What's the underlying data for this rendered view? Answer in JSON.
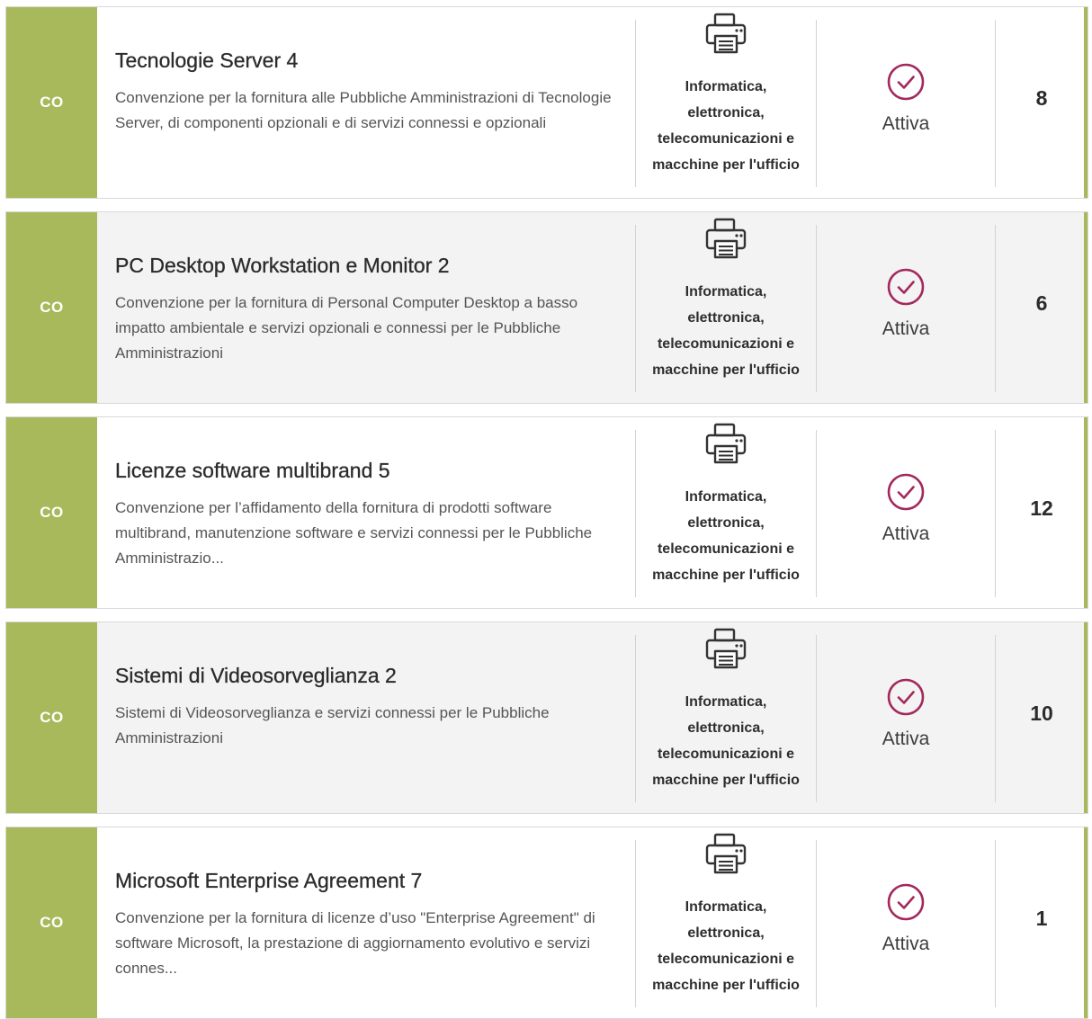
{
  "colors": {
    "type_badge_bg": "#a8b95c",
    "status_active": "#a3285d",
    "row_alt_bg": "#f3f3f3"
  },
  "items": [
    {
      "type": "CO",
      "title": "Tecnologie Server 4",
      "description": "Convenzione per la fornitura alle Pubbliche Amministrazioni di Tecnologie Server, di componenti opzionali e di servizi connessi e opzionali",
      "category_icon": "printer-icon",
      "category": "Informatica, elettronica, telecomunicazioni e macchine per l'ufficio",
      "status_icon": "check-circle-icon",
      "status": "Attiva",
      "count": "8"
    },
    {
      "type": "CO",
      "title": "PC Desktop Workstation e Monitor 2",
      "description": "Convenzione per la fornitura di Personal Computer Desktop a basso impatto ambientale e servizi opzionali e connessi per le Pubbliche Amministrazioni",
      "category_icon": "printer-icon",
      "category": "Informatica, elettronica, telecomunicazioni e macchine per l'ufficio",
      "status_icon": "check-circle-icon",
      "status": "Attiva",
      "count": "6"
    },
    {
      "type": "CO",
      "title": "Licenze software multibrand 5",
      "description": "Convenzione per l’affidamento della fornitura di prodotti software multibrand, manutenzione software e servizi connessi per le Pubbliche Amministrazio...",
      "category_icon": "printer-icon",
      "category": "Informatica, elettronica, telecomunicazioni e macchine per l'ufficio",
      "status_icon": "check-circle-icon",
      "status": "Attiva",
      "count": "12"
    },
    {
      "type": "CO",
      "title": "Sistemi di Videosorveglianza 2",
      "description": "Sistemi di Videosorveglianza e servizi connessi per le Pubbliche Amministrazioni",
      "category_icon": "printer-icon",
      "category": "Informatica, elettronica, telecomunicazioni e macchine per l'ufficio",
      "status_icon": "check-circle-icon",
      "status": "Attiva",
      "count": "10"
    },
    {
      "type": "CO",
      "title": "Microsoft Enterprise Agreement 7",
      "description": "Convenzione per la fornitura di licenze d’uso \"Enterprise Agreement\" di software Microsoft, la prestazione di aggiornamento evolutivo e servizi connes...",
      "category_icon": "printer-icon",
      "category": "Informatica, elettronica, telecomunicazioni e macchine per l'ufficio",
      "status_icon": "check-circle-icon",
      "status": "Attiva",
      "count": "1"
    }
  ]
}
